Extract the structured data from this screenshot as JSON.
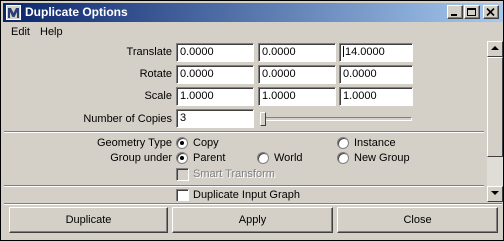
{
  "window": {
    "title": "Duplicate Options"
  },
  "menu": {
    "items": [
      "Edit",
      "Help"
    ]
  },
  "form": {
    "translate": {
      "label": "Translate",
      "x": "0.0000",
      "y": "0.0000",
      "z": "14.0000"
    },
    "rotate": {
      "label": "Rotate",
      "x": "0.0000",
      "y": "0.0000",
      "z": "0.0000"
    },
    "scale": {
      "label": "Scale",
      "x": "1.0000",
      "y": "1.0000",
      "z": "1.0000"
    },
    "copies": {
      "label": "Number of Copies",
      "value": "3"
    },
    "geometry_type": {
      "label": "Geometry Type",
      "options": [
        "Copy",
        "Instance"
      ],
      "selected": "Copy"
    },
    "group_under": {
      "label": "Group under",
      "options": [
        "Parent",
        "World",
        "New Group"
      ],
      "selected": "Parent"
    },
    "smart_transform": {
      "label": "Smart Transform",
      "checked": false,
      "enabled": false
    },
    "duplicate_input_graph": {
      "label": "Duplicate Input Graph",
      "checked": false
    }
  },
  "buttons": {
    "duplicate": "Duplicate",
    "apply": "Apply",
    "close": "Close"
  },
  "colors": {
    "titlebar_start": "#0a246a",
    "titlebar_end": "#a6caf0",
    "face": "#d4d0c8"
  }
}
